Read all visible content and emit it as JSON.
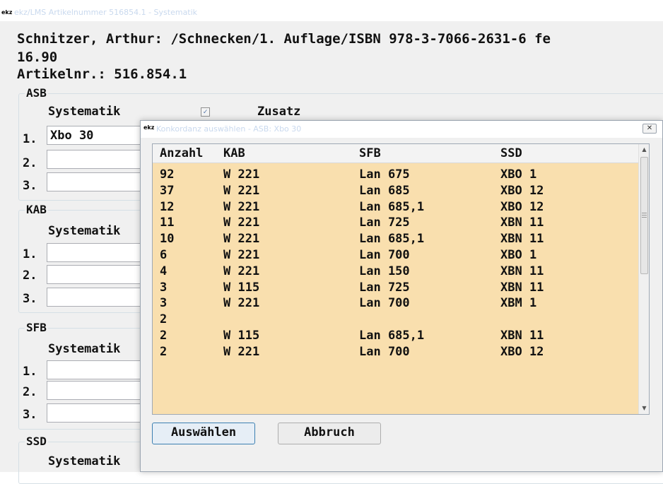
{
  "window": {
    "logo": "ekz",
    "title": "ekz/LMS Artikelnummer 516854.1 - Systematik"
  },
  "header": {
    "line1": "Schnitzer, Arthur: /Schnecken/1. Auflage/ISBN 978-3-7066-2631-6 fe",
    "line2": "16.90",
    "line3": "Artikelnr.: 516.854.1"
  },
  "groups": {
    "asb": {
      "legend": "ASB",
      "systematik_label": "Systematik",
      "zusatz_label": "Zusatz",
      "checkbox_mark": "✓",
      "rows": [
        {
          "num": "1.",
          "value": "Xbo 30"
        },
        {
          "num": "2.",
          "value": ""
        },
        {
          "num": "3.",
          "value": ""
        }
      ]
    },
    "kab": {
      "legend": "KAB",
      "systematik_label": "Systematik",
      "rows": [
        {
          "num": "1.",
          "value": ""
        },
        {
          "num": "2.",
          "value": ""
        },
        {
          "num": "3.",
          "value": ""
        }
      ]
    },
    "sfb": {
      "legend": "SFB",
      "systematik_label": "Systematik",
      "rows": [
        {
          "num": "1.",
          "value": ""
        },
        {
          "num": "2.",
          "value": ""
        },
        {
          "num": "3.",
          "value": ""
        }
      ]
    },
    "ssd": {
      "legend": "SSD",
      "systematik_label": "Systematik"
    }
  },
  "dialog": {
    "logo": "ekz",
    "title": "Konkordanz auswählen - ASB: Xbo 30",
    "close_label": "✕",
    "columns": [
      "Anzahl",
      "KAB",
      "SFB",
      "SSD"
    ],
    "rows": [
      {
        "anzahl": "92",
        "kab": "W 221",
        "sfb": "Lan 675",
        "ssd": "XBO 1"
      },
      {
        "anzahl": "37",
        "kab": "W 221",
        "sfb": "Lan 685",
        "ssd": "XBO 12"
      },
      {
        "anzahl": "12",
        "kab": "W 221",
        "sfb": "Lan 685,1",
        "ssd": "XBO 12"
      },
      {
        "anzahl": "11",
        "kab": "W 221",
        "sfb": "Lan 725",
        "ssd": "XBN 11"
      },
      {
        "anzahl": "10",
        "kab": "W 221",
        "sfb": "Lan 685,1",
        "ssd": "XBN 11"
      },
      {
        "anzahl": "6",
        "kab": "W 221",
        "sfb": "Lan 700",
        "ssd": "XBO 1"
      },
      {
        "anzahl": "4",
        "kab": "W 221",
        "sfb": "Lan 150",
        "ssd": "XBN 11"
      },
      {
        "anzahl": "3",
        "kab": "W 115",
        "sfb": "Lan 725",
        "ssd": "XBN 11"
      },
      {
        "anzahl": "3",
        "kab": "W 221",
        "sfb": "Lan 700",
        "ssd": "XBM 1"
      },
      {
        "anzahl": "2",
        "kab": "",
        "sfb": "",
        "ssd": ""
      },
      {
        "anzahl": "2",
        "kab": "W 115",
        "sfb": "Lan 685,1",
        "ssd": "XBN 11"
      },
      {
        "anzahl": "2",
        "kab": "W 221",
        "sfb": "Lan 700",
        "ssd": "XBO 12"
      }
    ],
    "scroll_up": "▲",
    "scroll_down": "▼",
    "select_button": "Auswählen",
    "cancel_button": "Abbruch"
  },
  "colors": {
    "grid_background": "#f9dfae",
    "window_background": "#f0f0f0",
    "focus_border": "#3c7fb1"
  }
}
